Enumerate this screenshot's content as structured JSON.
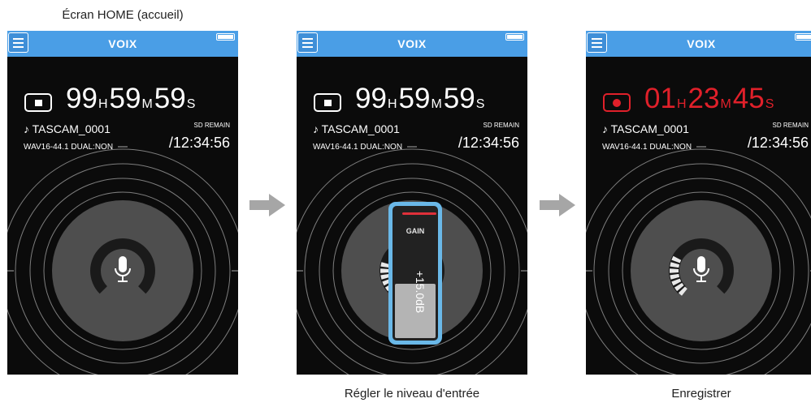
{
  "captions": {
    "screen1": "Écran HOME (accueil)",
    "screen2": "Régler le niveau d'entrée",
    "screen3": "Enregistrer"
  },
  "screens": [
    {
      "title": "VOIX",
      "status": "stop",
      "time": {
        "h": "99",
        "h_unit": "H",
        "m": "59",
        "m_unit": "M",
        "s": "59",
        "s_unit": "S"
      },
      "file_name": "♪ TASCAM_0001",
      "format": "WAV16-44.1 DUAL:NON",
      "sd_label": "SD REMAIN",
      "sd_remain": "/12:34:56",
      "level_segments_lit": 0
    },
    {
      "title": "VOIX",
      "status": "stop",
      "time": {
        "h": "99",
        "h_unit": "H",
        "m": "59",
        "m_unit": "M",
        "s": "59",
        "s_unit": "S"
      },
      "file_name": "♪ TASCAM_0001",
      "format": "WAV16-44.1 DUAL:NON",
      "sd_label": "SD REMAIN",
      "sd_remain": "/12:34:56",
      "level_segments_lit": 6,
      "gain": {
        "label": "GAIN",
        "value": "+15.0dB",
        "level_fraction": 0.42
      }
    },
    {
      "title": "VOIX",
      "status": "recording",
      "time": {
        "h": "01",
        "h_unit": "H",
        "m": "23",
        "m_unit": "M",
        "s": "45",
        "s_unit": "S"
      },
      "file_name": "♪ TASCAM_0001",
      "format": "WAV16-44.1 DUAL:NON",
      "sd_label": "SD REMAIN",
      "sd_remain": "/12:34:56",
      "level_segments_lit": 7
    }
  ],
  "icons": {
    "menu": "menu-icon",
    "battery": "battery-icon",
    "stop": "stop-icon",
    "record": "record-icon",
    "microphone": "microphone-icon",
    "arrow": "arrow-right-icon"
  },
  "colors": {
    "header_blue": "#4a9ee6",
    "record_red": "#e0202a",
    "gain_frame": "#6ab8e8",
    "arrow_gray": "#a6a6a6"
  }
}
